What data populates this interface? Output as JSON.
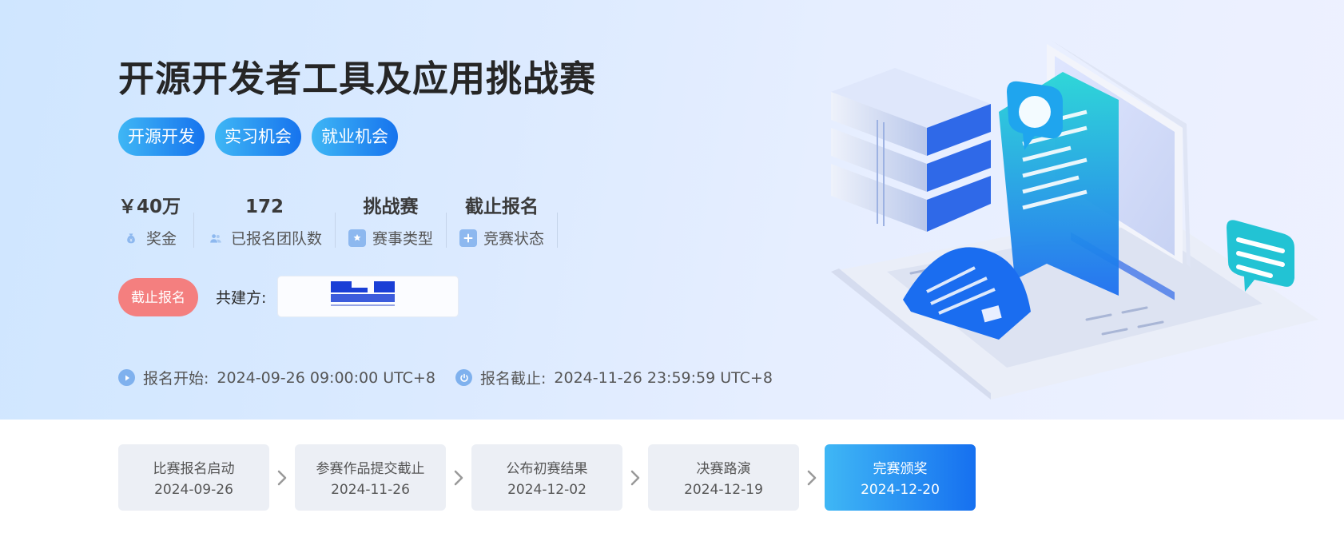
{
  "hero": {
    "title": "开源开发者工具及应用挑战赛",
    "tags": [
      "开源开发",
      "实习机会",
      "就业机会"
    ],
    "stats": [
      {
        "value": "￥40万",
        "label": "奖金",
        "icon": "money-bag-icon"
      },
      {
        "value": "172",
        "label": "已报名团队数",
        "icon": "team-icon"
      },
      {
        "value": "挑战赛",
        "label": "赛事类型",
        "icon": "badge-icon"
      },
      {
        "value": "截止报名",
        "label": "竞赛状态",
        "icon": "status-plus-icon"
      }
    ],
    "status_button": "截止报名",
    "cobuild_label": "共建方:",
    "start_label": "报名开始:",
    "start_time": "2024-09-26 09:00:00 UTC+8",
    "end_label": "报名截止:",
    "end_time": "2024-11-26 23:59:59 UTC+8"
  },
  "timeline": [
    {
      "label": "比赛报名启动",
      "date": "2024-09-26",
      "active": false
    },
    {
      "label": "参赛作品提交截止",
      "date": "2024-11-26",
      "active": false
    },
    {
      "label": "公布初赛结果",
      "date": "2024-12-02",
      "active": false
    },
    {
      "label": "决赛路演",
      "date": "2024-12-19",
      "active": false
    },
    {
      "label": "完赛颁奖",
      "date": "2024-12-20",
      "active": true
    }
  ],
  "colors": {
    "accent_blue": "#1673ee",
    "accent_cyan": "#3fb7f5",
    "status_red": "#f47f7f",
    "step_bg": "#eceff5"
  }
}
